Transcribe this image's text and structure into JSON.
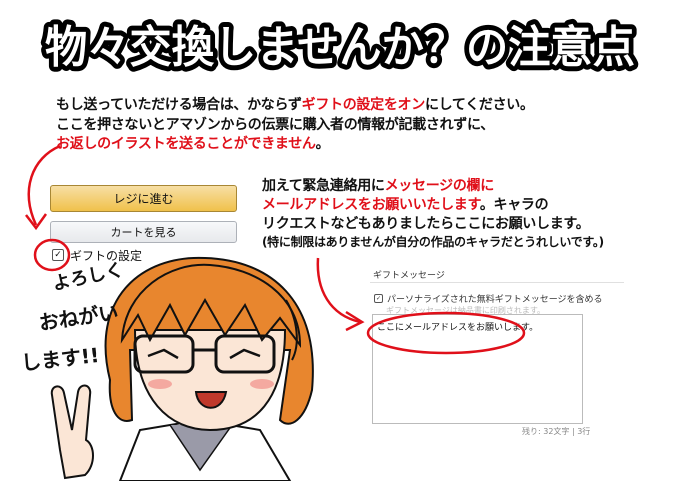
{
  "title": "物々交換しませんか？の注意点",
  "notice": {
    "line1": {
      "a": "もし送っていただける場合は、かならず",
      "b": "ギフトの設定をオン",
      "c": "にしてください。"
    },
    "line2": "ここを押さないとアマゾンからの伝票に購入者の情報が記載されずに、",
    "line3": {
      "a": "お返しのイラストを送ることができません",
      "b": "。"
    }
  },
  "cart": {
    "checkout_label": "レジに進む",
    "view_cart_label": "カートを見る",
    "gift_label": "ギフトの設定",
    "gift_checked": "✓"
  },
  "contact": {
    "line1": {
      "a": "加えて緊急連絡用に",
      "b": "メッセージの欄に"
    },
    "line2": {
      "a": "メールアドレスをお願いいたします",
      "b": "。キャラの"
    },
    "line3": "リクエストなどもありましたらここにお願いします。",
    "line4": "(特に制限はありませんが自分の作品のキャラだとうれしいです。)"
  },
  "gift_message": {
    "title": "ギフトメッセージ",
    "checkbox_label": "パーソナライズされた無料ギフトメッセージを含める",
    "sub": "ギフトメッセージは納品書に印刷されます。",
    "text": "ここにメールアドレスをお願いします。",
    "counter": "残り: 32文字 | 3行"
  },
  "handwriting": "よろしくおねがいします!!",
  "colors": {
    "accent_red": "#e0101a",
    "title_stroke": "#000000",
    "hair": "#e8862e"
  }
}
